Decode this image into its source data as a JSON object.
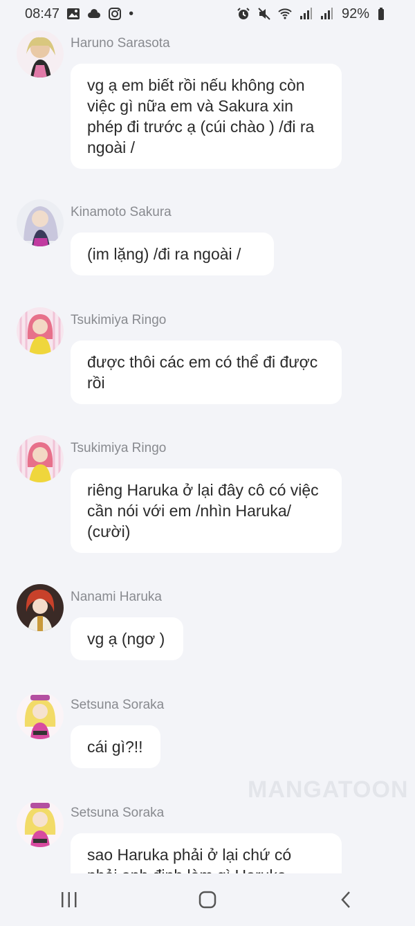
{
  "status_bar": {
    "time": "08:47",
    "dot": "•",
    "battery": "92%",
    "left_icons": [
      "gallery-icon",
      "cloud-icon",
      "instagram-icon"
    ],
    "right_icons": [
      "alarm-icon",
      "mute-icon",
      "wifi-icon",
      "signal-icon",
      "signal-icon",
      "battery-icon"
    ]
  },
  "messages": [
    {
      "sender": "Haruno Sarasota",
      "text": "vg ạ em biết rồi nếu không còn việc gì nữa em và Sakura xin phép đi trước ạ (cúi chào ) /đi ra ngoài /",
      "avatar_color": "#e7b7c8"
    },
    {
      "sender": "Kinamoto Sakura",
      "text": "(im lặng) /đi ra ngoài /",
      "avatar_color": "#b9b6d3"
    },
    {
      "sender": "Tsukimiya Ringo",
      "text": "được thôi các em có thể đi được rồi",
      "avatar_color": "#f0d24a"
    },
    {
      "sender": "Tsukimiya Ringo",
      "text": "riêng Haruka ở lại đây cô có việc cần nói với em /nhìn Haruka/ (cười)",
      "avatar_color": "#f0d24a"
    },
    {
      "sender": "Nanami Haruka",
      "text": "vg ạ (ngơ )",
      "avatar_color": "#b3462e"
    },
    {
      "sender": "Setsuna Soraka",
      "text": "cái gì?!!",
      "avatar_color": "#f3d35e"
    },
    {
      "sender": "Setsuna Soraka",
      "text": "sao Haruka phải ở lại chứ có phải anh định làm gì Haruka",
      "avatar_color": "#f3d35e"
    }
  ],
  "watermark": "MANGATOON",
  "nav": {
    "icons": [
      "recent-apps-icon",
      "home-icon",
      "back-icon"
    ]
  }
}
